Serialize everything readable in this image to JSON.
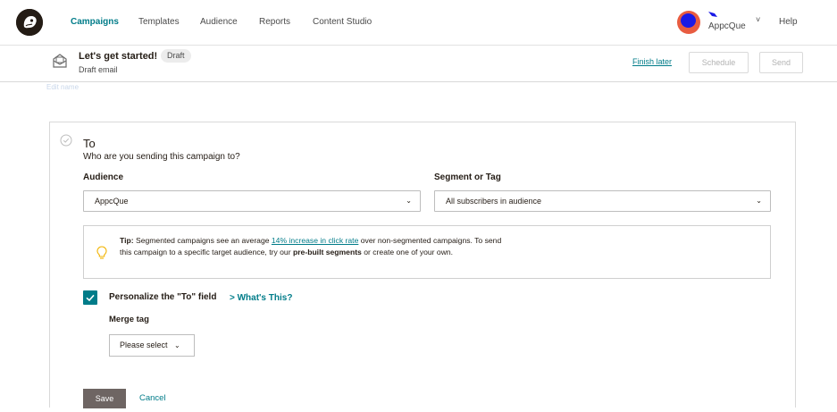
{
  "nav": {
    "items": [
      {
        "label": "Campaigns",
        "active": true
      },
      {
        "label": "Templates",
        "active": false
      },
      {
        "label": "Audience",
        "active": false
      },
      {
        "label": "Reports",
        "active": false
      },
      {
        "label": "Content Studio",
        "active": false
      }
    ],
    "account_name": "AppcQue",
    "account_caret": "˅",
    "help": "Help",
    "logo_icon": "mailchimp-logo-icon"
  },
  "subheader": {
    "title": "Let's get started!",
    "badge": "Draft",
    "type": "Draft email",
    "finish_later": "Finish later",
    "schedule": "Schedule",
    "send": "Send",
    "edit_name": "Edit name"
  },
  "to_section": {
    "title": "To",
    "subtitle": "Who are you sending this campaign to?",
    "audience_label": "Audience",
    "audience_value": "AppcQue",
    "segment_label": "Segment or Tag",
    "segment_value": "All subscribers in audience",
    "caret": "⌄",
    "tip": {
      "prefix": "Tip:",
      "text1": " Segmented campaigns see an average ",
      "link": "14% increase in click rate",
      "text2": " over non-segmented campaigns. To send this campaign to a specific target audience, try our ",
      "bold": "pre-built segments",
      "text3": " or create one of your own."
    },
    "personalize_label": "Personalize the \"To\" field",
    "personalize_checked": true,
    "whats_this": "> What's This?",
    "merge_label": "Merge tag",
    "merge_value": "Please select",
    "merge_caret": "⌄",
    "save": "Save",
    "cancel": "Cancel"
  },
  "colors": {
    "accent": "#007c89",
    "save_button": "#6e6563",
    "avatar_ring": "#e85c41",
    "avatar_inner": "#1a1ae6"
  }
}
